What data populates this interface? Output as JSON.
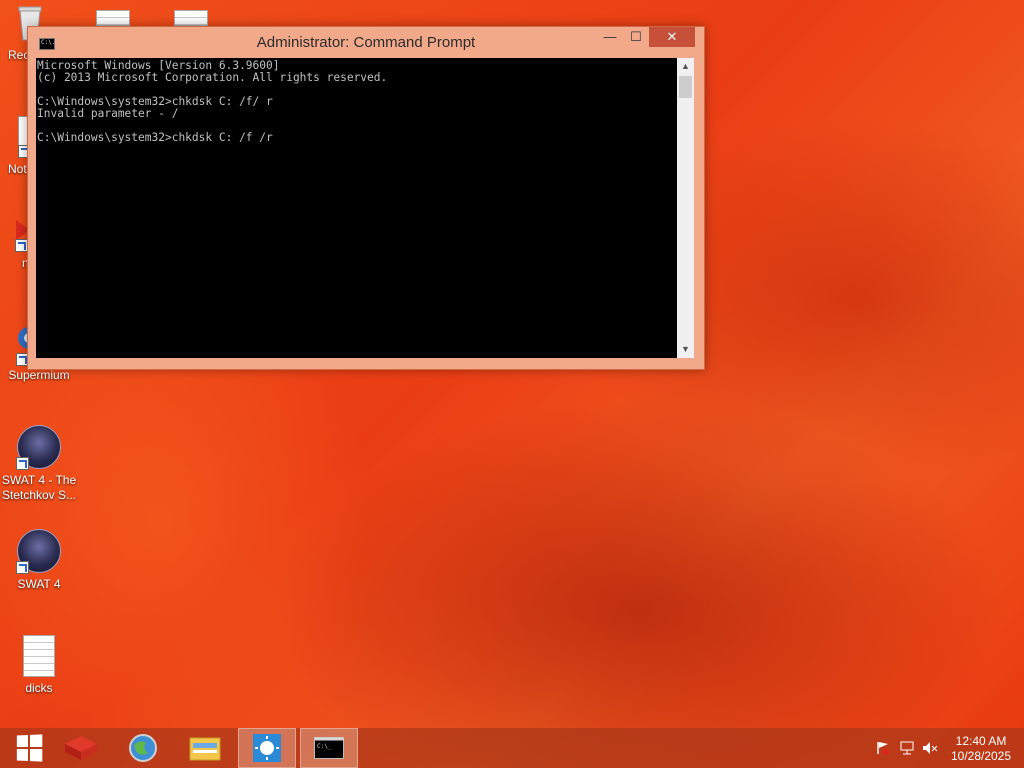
{
  "desktop_icons": [
    {
      "id": "recycle",
      "label": "Rec"
    },
    {
      "id": "notepad",
      "label": "Not"
    },
    {
      "id": "media",
      "label": "n"
    },
    {
      "id": "supermium",
      "label": "Supermium"
    },
    {
      "id": "swat4-stetchkov",
      "label": "SWAT 4 - The Stetchkov S..."
    },
    {
      "id": "swat4",
      "label": "SWAT 4"
    },
    {
      "id": "dicks",
      "label": "dicks"
    }
  ],
  "window": {
    "title": "Administrator: Command Prompt",
    "icon_text": "C:\\.",
    "minimize_glyph": "—",
    "maximize_glyph": "☐",
    "close_glyph": "✕",
    "console_lines": [
      "Microsoft Windows [Version 6.3.9600]",
      "(c) 2013 Microsoft Corporation. All rights reserved.",
      "",
      "C:\\Windows\\system32>chkdsk C: /f/ r",
      "Invalid parameter - /",
      "",
      "C:\\Windows\\system32>chkdsk C: /f /r"
    ]
  },
  "taskbar": {
    "items": [
      {
        "name": "start-button",
        "icon": "windows-logo-icon"
      },
      {
        "name": "taskbar-app-red",
        "icon": "red-cube-icon"
      },
      {
        "name": "taskbar-browser",
        "icon": "globe-browser-icon"
      },
      {
        "name": "taskbar-file-explorer",
        "icon": "folder-icon"
      },
      {
        "name": "taskbar-app-blue",
        "icon": "sun-app-icon",
        "active": true
      },
      {
        "name": "taskbar-command-prompt",
        "icon": "command-prompt-icon",
        "active": true
      }
    ],
    "tray": {
      "time": "12:40 AM",
      "date": "10/28/2025"
    }
  },
  "colors": {
    "accent_close": "#c7503b",
    "window_frame": "#f2a98a",
    "console_bg": "#000000",
    "console_fg": "#c0c0c0"
  }
}
